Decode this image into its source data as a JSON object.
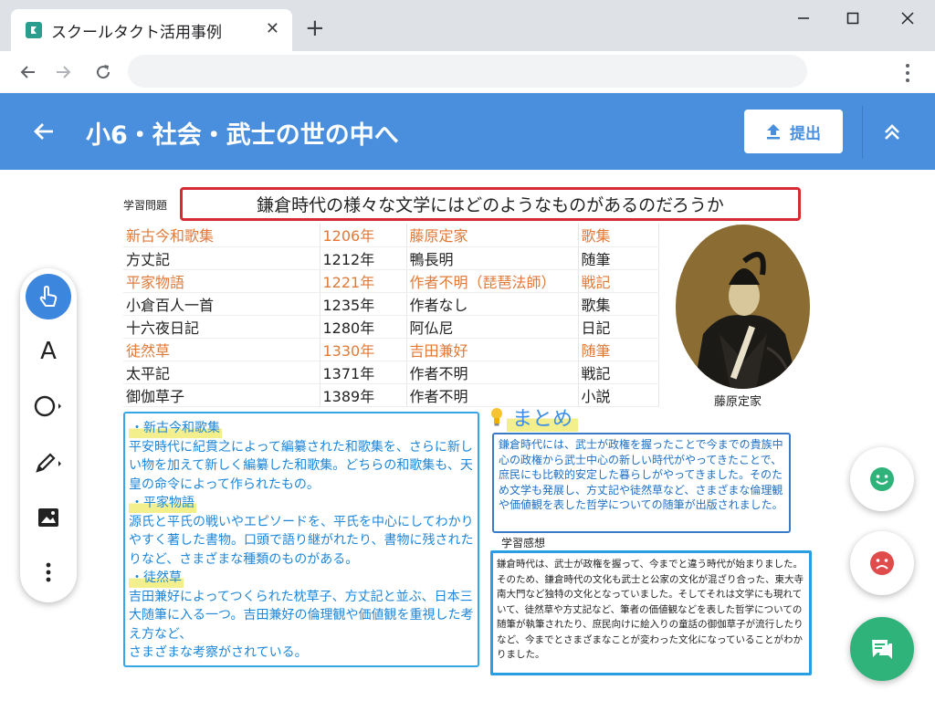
{
  "browser": {
    "tab_title": "スクールタクト活用事例",
    "tab_close": "✕",
    "new_tab": "+"
  },
  "header": {
    "title": "小6・社会・武士の世の中へ",
    "submit_label": "提出"
  },
  "slide": {
    "question_label": "学習問題",
    "question": "鎌倉時代の様々な文学にはどのようなものがあるのだろうか",
    "works": [
      {
        "title": "新古今和歌集",
        "year": "1206年",
        "author": "藤原定家",
        "genre": "歌集",
        "highlight": true
      },
      {
        "title": "方丈記",
        "year": "1212年",
        "author": "鴨長明",
        "genre": "随筆",
        "highlight": false
      },
      {
        "title": "平家物語",
        "year": "1221年",
        "author": "作者不明（琵琶法師）",
        "genre": "戦記",
        "highlight": true
      },
      {
        "title": "小倉百人一首",
        "year": "1235年",
        "author": "作者なし",
        "genre": "歌集",
        "highlight": false
      },
      {
        "title": "十六夜日記",
        "year": "1280年",
        "author": "阿仏尼",
        "genre": "日記",
        "highlight": false
      },
      {
        "title": "徒然草",
        "year": "1330年",
        "author": "吉田兼好",
        "genre": "随筆",
        "highlight": true
      },
      {
        "title": "太平記",
        "year": "1371年",
        "author": "作者不明",
        "genre": "戦記",
        "highlight": false
      },
      {
        "title": "御伽草子",
        "year": "1389年",
        "author": "作者不明",
        "genre": "小説",
        "highlight": false
      }
    ],
    "portrait_caption": "藤原定家",
    "notes": {
      "h1": "・新古今和歌集",
      "p1": "平安時代に紀貫之によって編纂された和歌集を、さらに新しい物を加えて新しく編纂した和歌集。どちらの和歌集も、天皇の命令によって作られたもの。",
      "h2": "・平家物語",
      "p2": "源氏と平氏の戦いやエピソードを、平氏を中心にしてわかりやすく著した書物。口頭で語り継がれたり、書物に残されたりなど、さまざまな種類のものがある。",
      "h3": "・徒然草",
      "p3": "吉田兼好によってつくられた枕草子、方丈記と並ぶ、日本三大随筆に入る一つ。吉田兼好の倫理観や価値観を重視した考え方など、",
      "p3b": "さまざまな考察がされている。"
    },
    "matome_title": "まとめ",
    "matome_text": "鎌倉時代には、武士が政権を握ったことで今までの貴族中心の政権から武士中心の新しい時代がやってきたことで、庶民にも比較的安定した暮らしがやってきました。そのため文学も発展し、方丈記や徒然草など、さまざまな倫理観や価値観を表した哲学についての随筆が出版されました。",
    "kanso_label": "学習感想",
    "kanso_text": "鎌倉時代は、武士が政権を握って、今までと違う時代が始まりました。そのため、鎌倉時代の文化も武士と公家の文化が混ざり合った、東大寺南大門など独特の文化となっていました。そしてそれは文学にも現れていて、徒然草や方丈記など、筆者の価値観などを表した哲学についての随筆が執筆されたり、庶民向けに絵入りの童話の御伽草子が流行したりなど、今までとさまざまなことが変わった文化になっていることがわかりました。"
  },
  "tools": {
    "text_tool": "A"
  },
  "colors": {
    "header_blue": "#4a8fdd",
    "highlight_orange": "#e07a3a",
    "question_border": "#d62a35",
    "note_blue": "#1d86d9",
    "good_green": "#2fb37a",
    "bad_red": "#e04b4b"
  }
}
